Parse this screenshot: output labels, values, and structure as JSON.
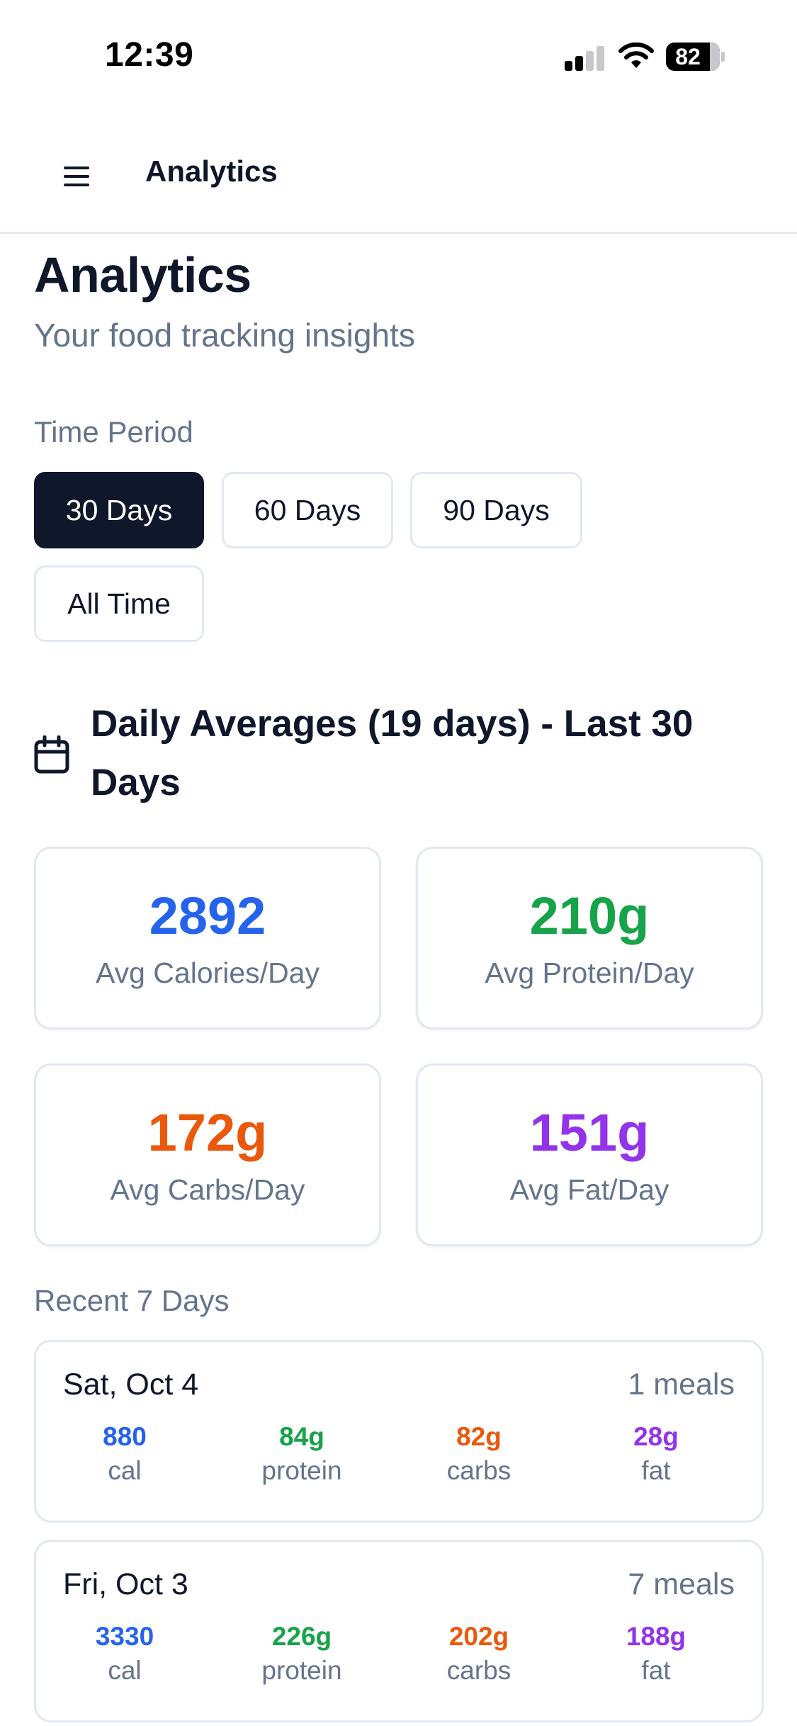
{
  "status_bar": {
    "time": "12:39",
    "battery": "82"
  },
  "nav": {
    "title": "Analytics",
    "menu_icon": "hamburger-menu-icon"
  },
  "header": {
    "title": "Analytics",
    "subtitle": "Your food tracking insights"
  },
  "time_period": {
    "label": "Time Period",
    "options": [
      "30 Days",
      "60 Days",
      "90 Days",
      "All Time"
    ],
    "selected": "30 Days"
  },
  "averages": {
    "title": "Daily Averages (19 days) - Last 30 Days",
    "icon": "calendar-icon",
    "calories": {
      "value": "2892",
      "label": "Avg Calories/Day"
    },
    "protein": {
      "value": "210g",
      "label": "Avg Protein/Day"
    },
    "carbs": {
      "value": "172g",
      "label": "Avg Carbs/Day"
    },
    "fat": {
      "value": "151g",
      "label": "Avg Fat/Day"
    }
  },
  "recent": {
    "label": "Recent 7 Days",
    "days": [
      {
        "date": "Sat, Oct 4",
        "meals": "1 meals",
        "cal": "880",
        "protein": "84g",
        "carbs": "82g",
        "fat": "28g"
      },
      {
        "date": "Fri, Oct 3",
        "meals": "7 meals",
        "cal": "3330",
        "protein": "226g",
        "carbs": "202g",
        "fat": "188g"
      }
    ],
    "labels": {
      "cal": "cal",
      "protein": "protein",
      "carbs": "carbs",
      "fat": "fat"
    }
  },
  "colors": {
    "calories": "#2563eb",
    "protein": "#16a34a",
    "carbs": "#ea580c",
    "fat": "#9333ea",
    "primary": "#0f172a",
    "muted": "#64748b"
  }
}
